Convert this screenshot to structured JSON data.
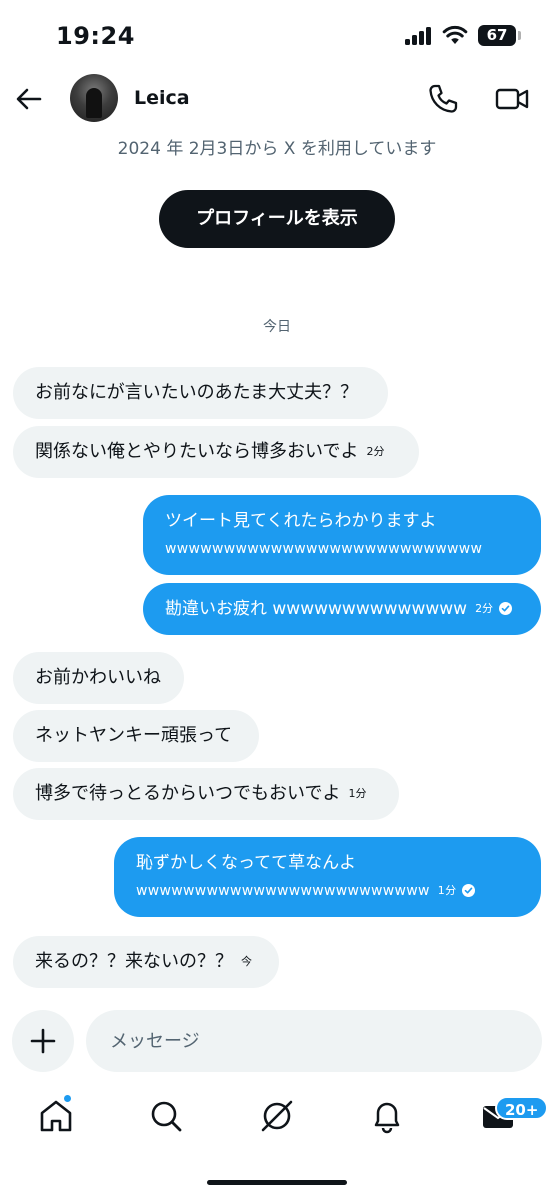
{
  "status_bar": {
    "time": "19:24",
    "battery": "67"
  },
  "header": {
    "name": "Leica",
    "joined": "2024 年 2月3日から X を利用しています",
    "view_profile": "プロフィールを表示"
  },
  "date_separator": "今日",
  "messages": [
    {
      "text": "お前なにが言いたいのあたま大丈夫？？",
      "time": ""
    },
    {
      "text": "関係ない俺とやりたいなら博多おいでよ",
      "time": "2分"
    },
    {
      "line1": "ツイート見てくれたらわかりますよ",
      "line2": "wwwwwwwwwwwwwwwwwwwwwwwwwww",
      "time": ""
    },
    {
      "text": "勘違いお疲れ wwwwwwwwwwwwww",
      "time": "2分"
    },
    {
      "text": "お前かわいいね",
      "time": ""
    },
    {
      "text": "ネットヤンキー頑張って",
      "time": ""
    },
    {
      "text": "博多で待っとるからいつでもおいでよ",
      "time": "1分"
    },
    {
      "line1": "恥ずかしくなってて草なんよ",
      "line2": "wwwwwwwwwwwwwwwwwwwwwwwww",
      "time": "1分"
    },
    {
      "text": "来るの？？来ないの？？",
      "time": "今"
    }
  ],
  "composer": {
    "placeholder": "メッセージ"
  },
  "nav": {
    "icons": [
      "home-icon",
      "search-icon",
      "grok-icon",
      "notifications-icon",
      "messages-icon"
    ],
    "messages_badge": "20+"
  },
  "colors": {
    "accent": "#1d9bf0",
    "bubble_received": "#eff3f4",
    "text": "#0f1419",
    "secondary_text": "#536471"
  }
}
